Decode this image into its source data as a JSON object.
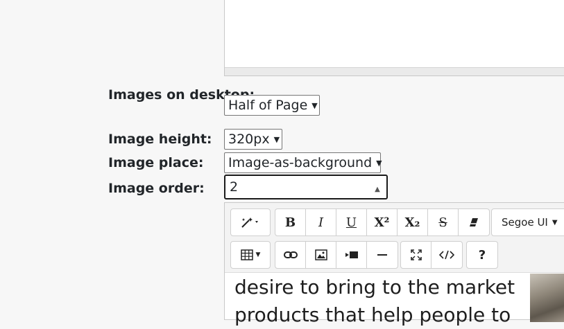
{
  "form": {
    "images_on_desktop": {
      "label": "Images on desktop:",
      "value": "Half of Page"
    },
    "image_height": {
      "label": "Image height:",
      "value": "320px"
    },
    "image_place": {
      "label": "Image place:",
      "value": "Image-as-background"
    },
    "image_order": {
      "label": "Image order:",
      "value": "2"
    }
  },
  "toolbar": {
    "font_family": "Segoe UI",
    "buttons": {
      "bold": "B",
      "italic": "I",
      "underline": "U",
      "superscript": "X²",
      "subscript": "X₂",
      "strikethrough": "S",
      "help": "?"
    }
  },
  "editor": {
    "content_line1": "desire to bring to the market",
    "content_line2": "products that help people to"
  }
}
